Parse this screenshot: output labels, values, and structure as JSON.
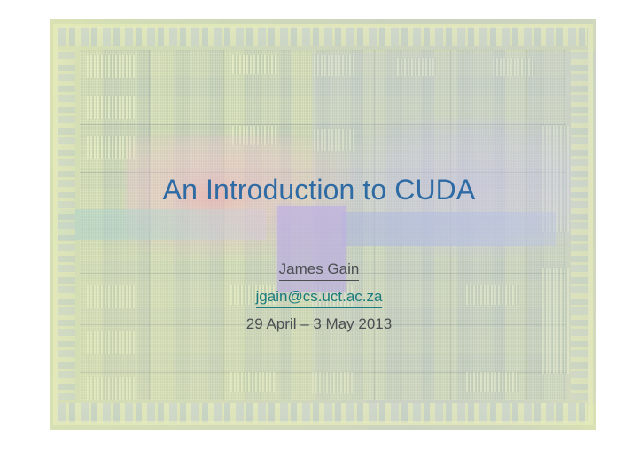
{
  "slide": {
    "title": "An Introduction to CUDA",
    "author": "James Gain",
    "email": "jgain@cs.uct.ac.za",
    "date": "29 April – 3 May 2013",
    "background_description": "gpu-die-photograph",
    "colors": {
      "title": "#2e6ba4",
      "author": "#4b4f51",
      "email_link": "#1a7b7d",
      "date": "#4b4f51",
      "canvas": "#ffffff"
    }
  }
}
